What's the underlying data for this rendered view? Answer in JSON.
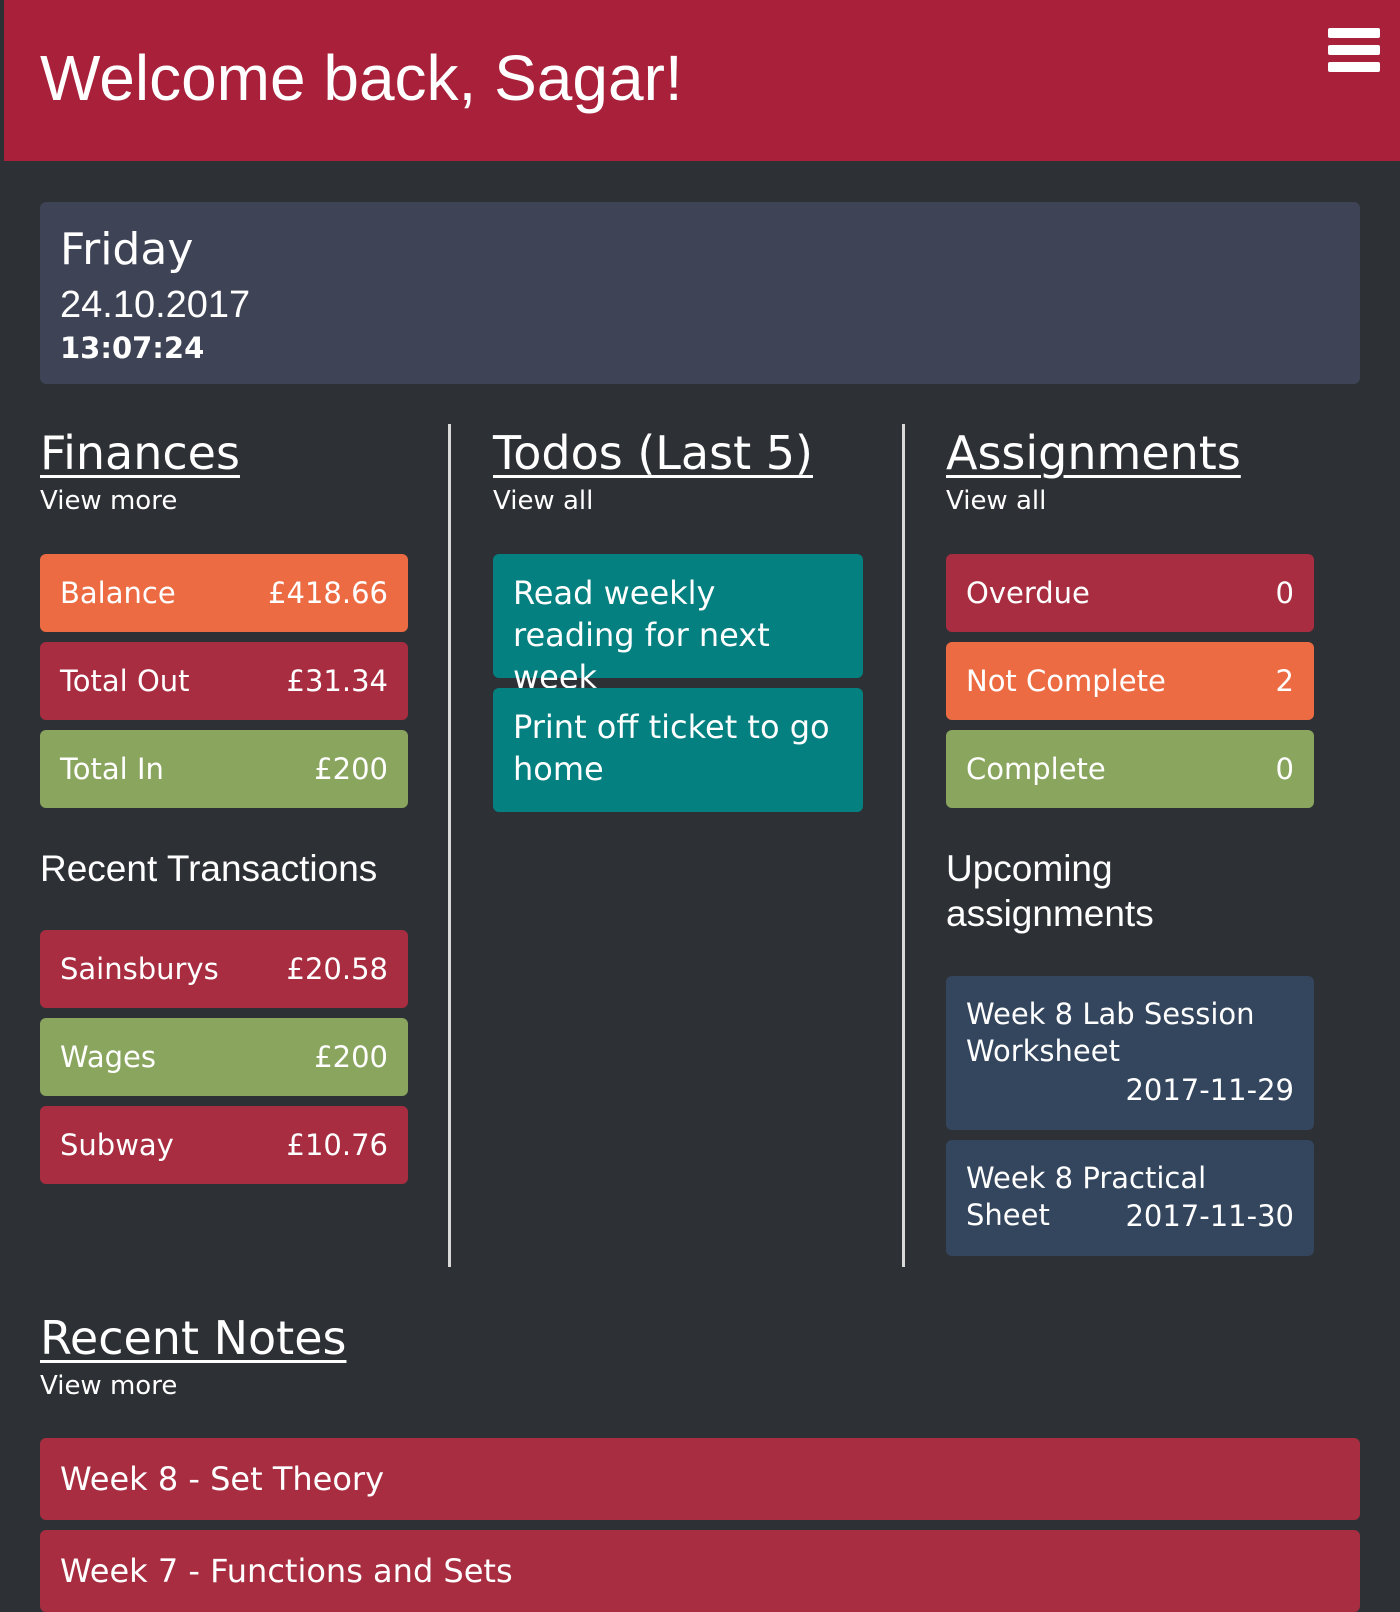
{
  "header": {
    "title": "Welcome back, Sagar!",
    "menu_icon": "hamburger-menu-icon",
    "background": "#a8203a"
  },
  "date_panel": {
    "day": "Friday",
    "date": "24.10.2017",
    "time": "13:07:24"
  },
  "finances": {
    "title": "Finances",
    "link": "View more",
    "summary": [
      {
        "label": "Balance",
        "value": "£418.66",
        "color": "#ec6b43"
      },
      {
        "label": "Total Out",
        "value": "£31.34",
        "color": "#a82d40"
      },
      {
        "label": "Total In",
        "value": "£200",
        "color": "#89a55e"
      }
    ],
    "recent_heading": "Recent Transactions",
    "transactions": [
      {
        "label": "Sainsburys",
        "value": "£20.58",
        "color": "#a82d40"
      },
      {
        "label": "Wages",
        "value": "£200",
        "color": "#89a55e"
      },
      {
        "label": "Subway",
        "value": "£10.76",
        "color": "#a82d40"
      }
    ]
  },
  "todos": {
    "title": "Todos (Last 5)",
    "link": "View all",
    "items": [
      {
        "text": "Read weekly reading for next week"
      },
      {
        "text": "Print off ticket to go home"
      }
    ],
    "color": "#03807f"
  },
  "assignments": {
    "title": "Assignments",
    "link": "View all",
    "summary": [
      {
        "label": "Overdue",
        "value": "0",
        "color": "#a82d40"
      },
      {
        "label": "Not Complete",
        "value": "2",
        "color": "#ec6b43"
      },
      {
        "label": "Complete",
        "value": "0",
        "color": "#89a55e"
      }
    ],
    "upcoming_heading": "Upcoming assignments",
    "upcoming": [
      {
        "title": "Week 8 Lab Session Worksheet",
        "date": "2017-11-29"
      },
      {
        "title": "Week 8 Practical Sheet",
        "date": "2017-11-30"
      }
    ],
    "upcoming_color": "#33465e"
  },
  "notes": {
    "title": "Recent Notes",
    "link": "View more",
    "items": [
      {
        "title": "Week 8 - Set Theory"
      },
      {
        "title": "Week 7 - Functions and Sets"
      }
    ],
    "color": "#a82d40"
  }
}
